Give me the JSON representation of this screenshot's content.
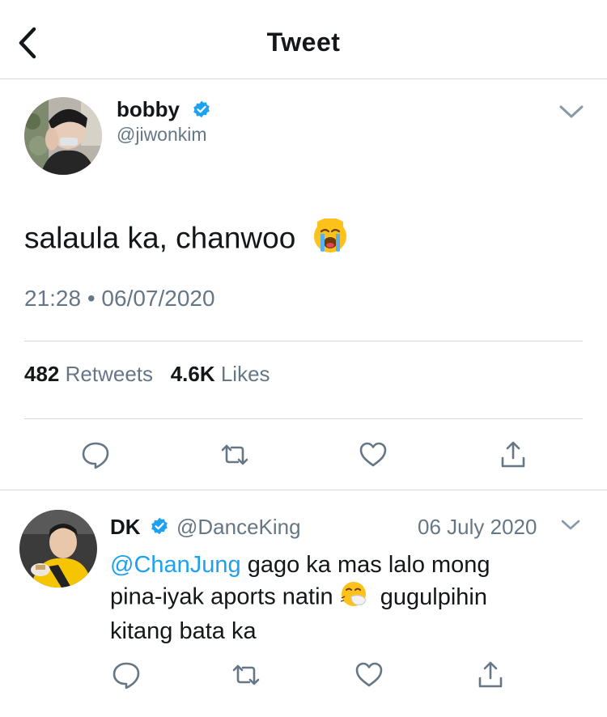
{
  "header": {
    "title": "Tweet"
  },
  "tweet": {
    "author_name": "bobby",
    "author_handle": "@jiwonkim",
    "text": "salaula ka, chanwoo",
    "timestamp": "21:28 • 06/07/2020",
    "retweets_count": "482",
    "retweets_label": "Retweets",
    "likes_count": "4.6K",
    "likes_label": "Likes"
  },
  "reply": {
    "author_name": "DK",
    "author_handle": "@DanceKing",
    "date": "06 July 2020",
    "mention": "@ChanJung",
    "text_line1": " gago ka mas lalo mong",
    "text_line2_a": "pina-iyak aports natin ",
    "text_line2_b": " gugulpihin",
    "text_line3": "kitang bata ka"
  },
  "icons": {
    "back": "chevron-left-icon",
    "verified": "verified-badge-icon",
    "more": "chevron-down-icon",
    "reply": "reply-icon",
    "retweet": "retweet-icon",
    "like": "heart-icon",
    "share": "share-icon",
    "emoji_crying": "loudly-crying-face-emoji",
    "emoji_sneezing": "sneezing-face-emoji"
  },
  "colors": {
    "accent": "#1da1f2",
    "secondary_text": "#657786",
    "divider": "#d6d9dc"
  }
}
